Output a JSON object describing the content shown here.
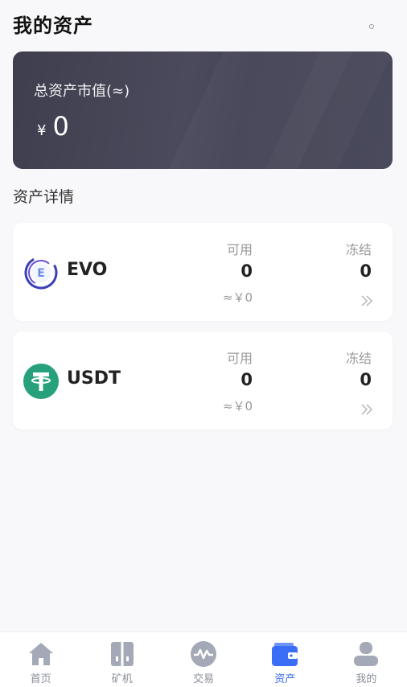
{
  "header": {
    "title": "我的资产"
  },
  "total": {
    "label": "总资产市值(≈)",
    "currency": "¥",
    "value": "0"
  },
  "section": {
    "title": "资产详情"
  },
  "assets": [
    {
      "name": "EVO",
      "icon": "evo-coin-icon",
      "available_label": "可用",
      "available": "0",
      "available_approx": "≈￥0",
      "frozen_label": "冻结",
      "frozen": "0"
    },
    {
      "name": "USDT",
      "icon": "tether-coin-icon",
      "available_label": "可用",
      "available": "0",
      "available_approx": "≈￥0",
      "frozen_label": "冻结",
      "frozen": "0"
    }
  ],
  "nav": {
    "items": [
      {
        "label": "首页",
        "icon": "home-icon"
      },
      {
        "label": "矿机",
        "icon": "miner-icon"
      },
      {
        "label": "交易",
        "icon": "trade-icon"
      },
      {
        "label": "资产",
        "icon": "wallet-icon",
        "active": true
      },
      {
        "label": "我的",
        "icon": "user-icon"
      }
    ]
  },
  "colors": {
    "accent": "#3b6ef6",
    "card_dark": "#454456",
    "tether_green": "#26a17b",
    "nav_gray": "#a3a9b6"
  }
}
